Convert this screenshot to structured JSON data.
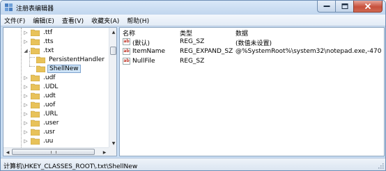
{
  "window": {
    "title": "注册表编辑器"
  },
  "menu": [
    {
      "label": "文件(F)"
    },
    {
      "label": "编辑(E)"
    },
    {
      "label": "查看(V)"
    },
    {
      "label": "收藏夹(A)"
    },
    {
      "label": "帮助(H)"
    }
  ],
  "tree": {
    "items": [
      {
        "label": ".ttf",
        "arrow": "▷"
      },
      {
        "label": ".tts",
        "arrow": "▷"
      },
      {
        "label": ".txt",
        "arrow": "◢"
      },
      {
        "label": "PersistentHandler",
        "arrow": ""
      },
      {
        "label": "ShellNew",
        "arrow": ""
      },
      {
        "label": ".udf",
        "arrow": "▷"
      },
      {
        "label": ".UDL",
        "arrow": "▷"
      },
      {
        "label": ".udt",
        "arrow": "▷"
      },
      {
        "label": ".uof",
        "arrow": "▷"
      },
      {
        "label": ".URL",
        "arrow": "▷"
      },
      {
        "label": ".user",
        "arrow": "▷"
      },
      {
        "label": ".usr",
        "arrow": "▷"
      },
      {
        "label": ".uu",
        "arrow": "▷"
      }
    ]
  },
  "values": {
    "columns": {
      "name": "名称",
      "type": "类型",
      "data": "数据"
    },
    "rows": [
      {
        "name": "(默认)",
        "type": "REG_SZ",
        "data": "(数值未设置)"
      },
      {
        "name": "ItemName",
        "type": "REG_EXPAND_SZ",
        "data": "@%SystemRoot%\\system32\\notepad.exe,-470"
      },
      {
        "name": "NullFile",
        "type": "REG_SZ",
        "data": ""
      }
    ]
  },
  "status": {
    "path": "计算机\\HKEY_CLASSES_ROOT\\.txt\\ShellNew"
  },
  "colors": {
    "folder": "#e8c25a",
    "selection": "#cde3f7",
    "close_button": "#c7503c"
  }
}
